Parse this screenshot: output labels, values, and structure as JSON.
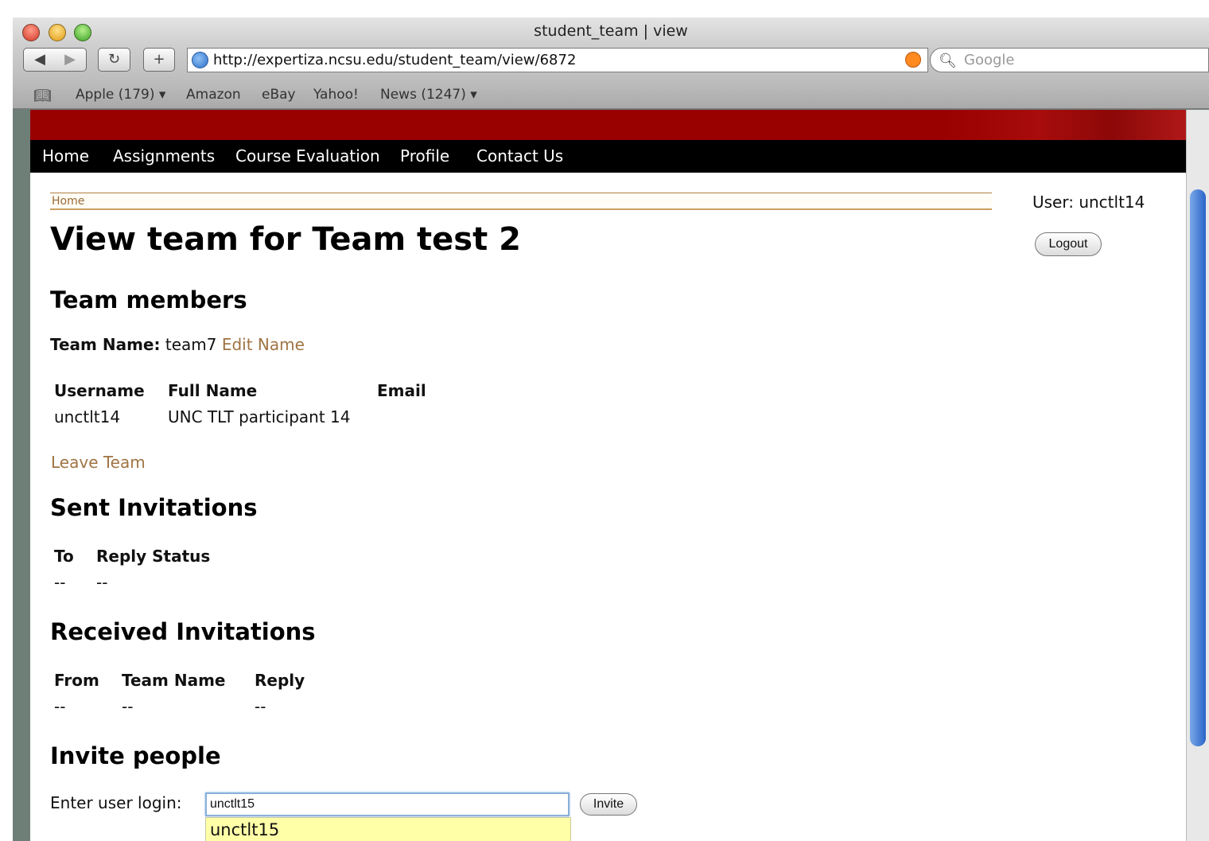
{
  "browser": {
    "window_title": "student_team | view",
    "url": "http://expertiza.ncsu.edu/student_team/view/6872",
    "search_placeholder": "Google",
    "bookmarks": [
      "Apple (179) ▾",
      "Amazon",
      "eBay",
      "Yahoo!",
      "News (1247) ▾"
    ]
  },
  "nav": [
    "Home",
    "Assignments",
    "Course Evaluation",
    "Profile",
    "Contact Us"
  ],
  "breadcrumb": "Home",
  "user": {
    "label": "User: unctlt14",
    "logout": "Logout"
  },
  "page": {
    "title": "View team for Team test 2",
    "team_members_heading": "Team members",
    "team_name_label": "Team Name:",
    "team_name_value": "team7",
    "edit_name": "Edit Name",
    "members_table": {
      "headers": [
        "Username",
        "Full Name",
        "Email"
      ],
      "rows": [
        [
          "unctlt14",
          "UNC TLT participant 14",
          ""
        ]
      ]
    },
    "leave_team": "Leave Team",
    "sent_heading": "Sent Invitations",
    "sent_table": {
      "headers": [
        "To",
        "Reply Status"
      ],
      "rows": [
        [
          "--",
          "--"
        ]
      ]
    },
    "received_heading": "Received Invitations",
    "received_table": {
      "headers": [
        "From",
        "Team Name",
        "Reply"
      ],
      "rows": [
        [
          "--",
          "--",
          "--"
        ]
      ]
    },
    "invite_heading": "Invite people",
    "invite_label": "Enter user login:",
    "invite_value": "unctlt15",
    "invite_button": "Invite",
    "suggestion": "unctlt15"
  },
  "colors": {
    "banner_red": "#990000",
    "nav_black": "#000000",
    "link_brown": "#a07443",
    "suggestion_yellow": "#ffffa8"
  }
}
